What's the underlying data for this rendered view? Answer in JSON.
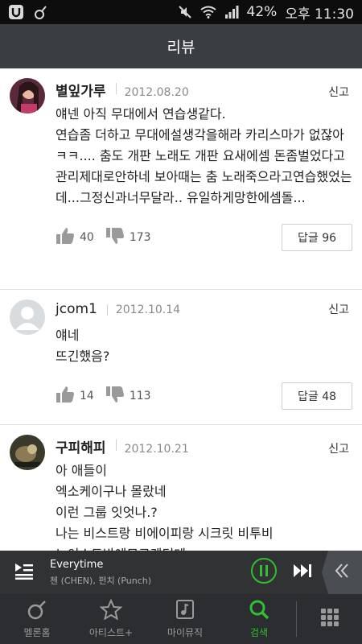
{
  "status_bar": {
    "battery": "42%",
    "time": "오후 11:30",
    "icons": [
      "melon-u-icon",
      "melon-note-icon",
      "mute-icon",
      "wifi-icon",
      "signal-icon"
    ]
  },
  "header": {
    "title": "리뷰"
  },
  "reviews": [
    {
      "author": "별잎가루",
      "date": "2012.08.20",
      "report_label": "신고",
      "text": "얘넨 아직 무대에서 연습생같다.\n연습좀 더하고 무대에설생각을해라 카리스마가 없잖아 ㅋㅋ.... 춤도 개판 노래도 개판 요새에셈 돈좀벌었다고 관리제대로안하네 보아때는 춤 노래죽으라고연습했었는데...그정신과너무달라.. 유일하게망한에셈돌...",
      "likes": "40",
      "dislikes": "173",
      "reply_label": "답글 96"
    },
    {
      "author": "jcom1",
      "date": "2012.10.14",
      "report_label": "신고",
      "text": "얘네\n뜨긴했음?",
      "likes": "14",
      "dislikes": "113",
      "reply_label": "답글 48"
    },
    {
      "author": "구피해피",
      "date": "2012.10.21",
      "report_label": "신고",
      "text": "아 애들이\n엑소케이구나 몰랐네\n이런 그룹 잇엇나.?\n나는 비스트랑 비에이피랑 시크릿 비투비 \n노이스트밖에모르겟던데\n근데 얘들 인기잇어요?없는거같음 신인상은"
    }
  ],
  "now_playing": {
    "song": "Everytime",
    "artist": "첸 (CHEN), 펀치 (Punch)"
  },
  "bottom_nav": [
    {
      "label": "멜론홈",
      "icon": "melon-home-icon",
      "active": false
    },
    {
      "label": "아티스트+",
      "icon": "star-icon",
      "active": false
    },
    {
      "label": "마이뮤직",
      "icon": "music-box-icon",
      "active": false
    },
    {
      "label": "검색",
      "icon": "search-icon",
      "active": true
    }
  ],
  "colors": {
    "accent": "#2fbf2f",
    "header_bg": "#3a3d42",
    "nav_bg": "#2b2d30"
  }
}
